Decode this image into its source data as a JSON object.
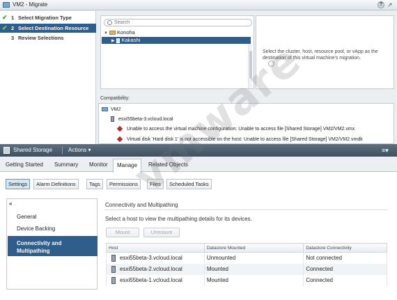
{
  "dialog": {
    "title": "VM2 - Migrate",
    "help": "?",
    "steps": [
      {
        "num": "1",
        "label": "Select Migration Type",
        "done": true
      },
      {
        "num": "2",
        "label": "Select Destination Resource",
        "done": true
      },
      {
        "num": "3",
        "label": "Review Selections",
        "done": false
      }
    ],
    "search": {
      "placeholder": "Search"
    },
    "tree": {
      "root": "Konoha",
      "selected": "Kakashi"
    },
    "hint": "Select the cluster, host, resource pool, or vApp as the destination of this virtual machine's migration.",
    "compatibility": {
      "label": "Compatibility:",
      "vm": "VM2",
      "host": "esxi55beta-3.vcloud.local",
      "errors": [
        "Unable to access the virtual machine configuration: Unable to access file [Shared Storage] VM2/VM2.vmx",
        "Virtual disk 'Hard disk 1' is not accessible on the host: Unable to access file [Shared Storage] VM2/VM2.vmdk"
      ]
    }
  },
  "object": {
    "title": "Shared Storage",
    "actions": "Actions ▾"
  },
  "tabs": [
    "Getting Started",
    "Summary",
    "Monitor",
    "Manage",
    "Related Objects"
  ],
  "active_tab": "Manage",
  "subtabs": [
    "Settings",
    "Alarm Definitions",
    "Tags",
    "Permissions",
    "Files",
    "Scheduled Tasks"
  ],
  "active_subtab": "Settings",
  "nav": {
    "collapse": "«",
    "items": [
      "General",
      "Device Backing"
    ],
    "active_line1": "Connectivity and",
    "active_line2": "Multipathing"
  },
  "main": {
    "title": "Connectivity and Multipathing",
    "description": "Select a host to view the multipathing details for its devices.",
    "buttons": {
      "mount": "Mount",
      "unmount": "Unmount"
    },
    "columns": [
      "Host",
      "Datastore Mounted",
      "Datastore Connectivity"
    ],
    "rows": [
      [
        "esxi55beta-3.vcloud.local",
        "Unmounted",
        "Not connected"
      ],
      [
        "esxi55beta-2.vcloud.local",
        "Mounted",
        "Connected"
      ],
      [
        "esxi55beta-1.vcloud.local",
        "Mounted",
        "Connected"
      ]
    ]
  },
  "watermark": "vmware"
}
